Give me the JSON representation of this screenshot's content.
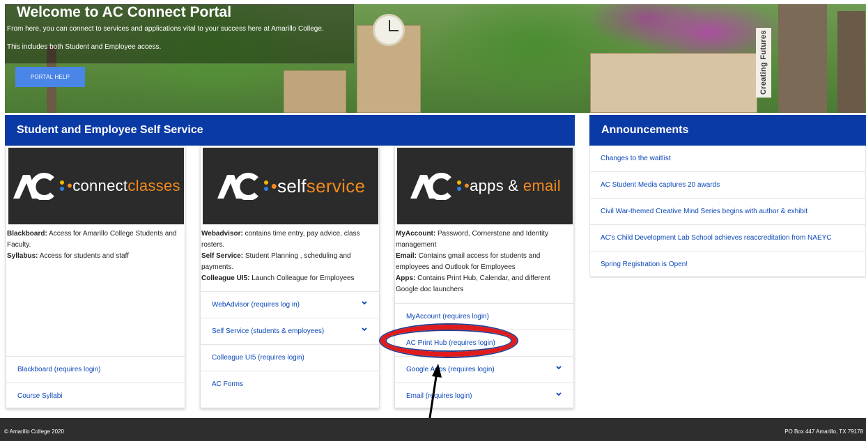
{
  "hero": {
    "title": "Welcome to AC Connect Portal",
    "line1": "From here, you can connect to services and applications vital to your success here at Amarillo College.",
    "line2": "This includes both Student and Employee access.",
    "help_button": "PORTAL HELP",
    "sign_text": "Creating Futures"
  },
  "services": {
    "heading": "Student and Employee Self Service",
    "cards": [
      {
        "logo_main": "connect",
        "logo_accent": "classes",
        "desc": [
          {
            "label": "Blackboard:",
            "text": " Access for Amarillo College Students and Faculty."
          },
          {
            "label": "Syllabus:",
            "text": " Access for students and staff"
          }
        ],
        "links": [
          "Blackboard (requires login)",
          "Course Syllabi"
        ]
      },
      {
        "logo_main": "self",
        "logo_accent": "service",
        "desc": [
          {
            "label": "Webadvisor:",
            "text": " contains time entry, pay advice, class rosters."
          },
          {
            "label": "Self Service:",
            "text": " Student Planning , scheduling and payments."
          },
          {
            "label": "Colleague UI5:",
            "text": " Launch Colleague for Employees"
          }
        ],
        "links": [
          "WebAdvisor (requires log in)",
          "Self Service (students & employees)",
          "Colleague UI5 (requires login)",
          "AC Forms"
        ]
      },
      {
        "logo_main": "apps & ",
        "logo_accent": "email",
        "desc": [
          {
            "label": "MyAccount:",
            "text": " Password, Cornerstone and Identity management"
          },
          {
            "label": "Email:",
            "text": " Contains gmail access for students and employees and Outlook for Employees"
          },
          {
            "label": "Apps:",
            "text": " Contains Print Hub, Calendar, and different Google doc launchers"
          }
        ],
        "links": [
          "MyAccount (requires login)",
          "AC Print Hub (requires login)",
          "Google Apps (requires login)",
          "Email (requires login)"
        ]
      }
    ]
  },
  "announcements": {
    "heading": "Announcements",
    "items": [
      "Changes to the waitlist",
      "AC Student Media captures 20 awards",
      "Civil War-themed Creative Mind Series begins with author & exhibit",
      "AC's Child Development Lab School achieves reaccreditation from NAEYC",
      "Spring Registration is Open!"
    ]
  },
  "footer": {
    "copyright": "© Amarillo College 2020",
    "address": "PO Box 447 Amarillo, TX 79178"
  },
  "colors": {
    "brand_blue": "#0a3aa6",
    "link_blue": "#0b47b8",
    "accent_orange": "#f28a1e",
    "help_button": "#4a86e8",
    "annotation_red": "#e11b1b"
  },
  "icons": [
    "ac-logo-icon",
    "chevron-down-icon",
    "annotation-arrow-icon"
  ]
}
